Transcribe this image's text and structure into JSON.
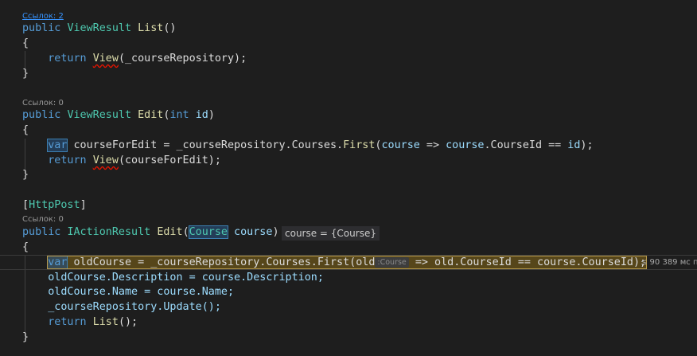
{
  "editor": {
    "lens_refs_2": "Ссылок: 2",
    "lens_refs_0_a": "Ссылок: 0",
    "lens_refs_0_b": "Ссылок: 0",
    "list_method": {
      "kw_public": "public",
      "type": "ViewResult",
      "name": "List",
      "parens": "()",
      "open_brace": "{",
      "return_kw": "return",
      "view_fn": "View",
      "view_args": "(_courseRepository);",
      "close_brace": "}"
    },
    "edit_method": {
      "kw_public": "public",
      "type": "ViewResult",
      "name": "Edit",
      "open_paren": "(",
      "int_kw": "int",
      "param": "id",
      "close_paren": ")",
      "open_brace": "{",
      "var_kw": "var",
      "var_name": " courseForEdit = _courseRepository.Courses.",
      "first_fn": "First",
      "lambda_open": "(",
      "lambda_param": "course",
      "arrow": " => ",
      "lambda_body": "course",
      "member": ".CourseId == ",
      "id_ref": "id",
      "end": ");",
      "return_kw": "return",
      "view_fn": "View",
      "view_args": "(courseForEdit);",
      "close_brace": "}"
    },
    "post_method": {
      "attribute_open": "[",
      "attribute": "HttpPost",
      "attribute_close": "]",
      "kw_public": "public",
      "type": "IActionResult",
      "name": "Edit",
      "open_paren": "(",
      "param_type": "Course",
      "param_name": " course",
      "close_paren": ")",
      "datatip": "course = {Course}",
      "open_brace": "{",
      "var_kw": "var",
      "line1_rest_a": " oldCourse = _courseRepository.Courses.First(old",
      "inlay_hint": ":Course",
      "line1_rest_b": " => old.CourseId == course.CourseId);",
      "perf_tip": "≤ 90 389 мс пр",
      "line2": "oldCourse.Description = course.Description;",
      "line3": "oldCourse.Name = course.Name;",
      "line4": "_courseRepository.Update();",
      "line5_kw": "return",
      "line5_fn": "List",
      "line5_rest": "();",
      "close_brace": "}"
    }
  }
}
